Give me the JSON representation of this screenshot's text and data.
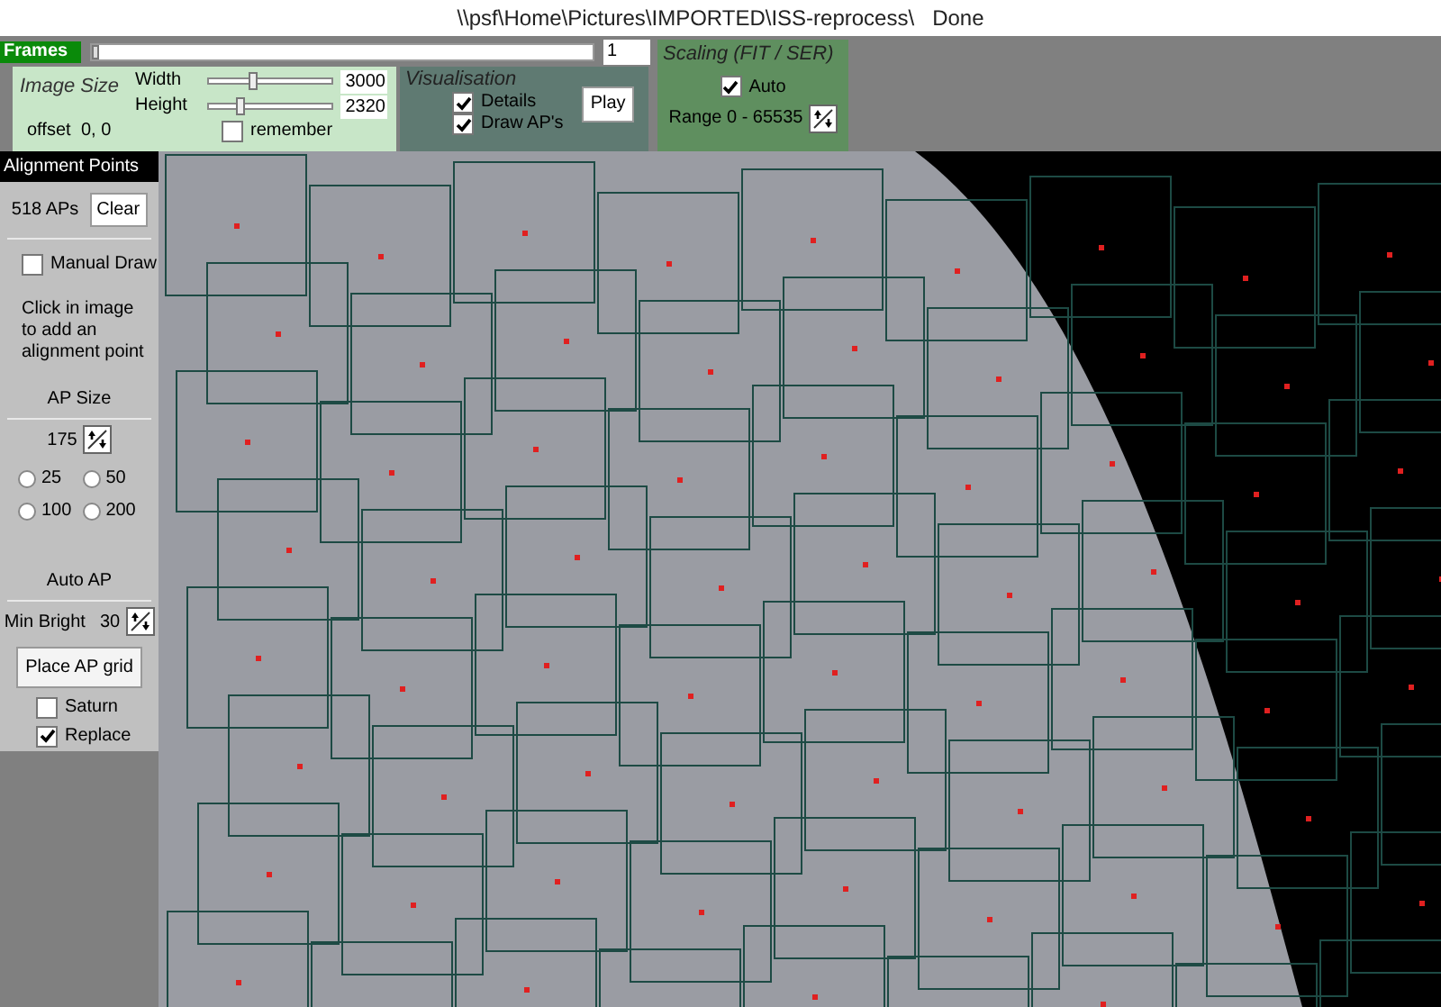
{
  "window": {
    "title": "\\\\psf\\Home\\Pictures\\IMPORTED\\ISS-reprocess\\   Done"
  },
  "frames": {
    "label": "Frames",
    "level": 0,
    "value": "1"
  },
  "image_size": {
    "title": "Image Size",
    "width_label": "Width",
    "width_slider": {
      "level": 0.35
    },
    "width_value": "3000",
    "height_label": "Height",
    "height_slider": {
      "level": 0.25
    },
    "height_value": "2320",
    "offset_label": "offset",
    "offset_value": "0, 0",
    "remember": {
      "label": "remember",
      "checked": false
    }
  },
  "visualisation": {
    "title": "Visualisation",
    "options": [
      {
        "label": "Details",
        "checked": true
      },
      {
        "label": "Draw AP's",
        "checked": true
      }
    ],
    "play": "Play"
  },
  "scaling": {
    "title": "Scaling (FIT / SER)",
    "auto": {
      "label": "Auto",
      "checked": true
    },
    "range": "Range 0 - 65535"
  },
  "sidebar": {
    "header": "Alignment Points",
    "count": "518 APs",
    "clear": "Clear",
    "manual_draw": {
      "label": "Manual Draw",
      "checked": false
    },
    "hint": "Click in image to add an alignment point",
    "ap_size_title": "AP Size",
    "ap_size_value": "175",
    "sizes": [
      {
        "label": "25",
        "selected": false
      },
      {
        "label": "50",
        "selected": false
      },
      {
        "label": "100",
        "selected": false
      },
      {
        "label": "200",
        "selected": false
      }
    ],
    "auto_ap_title": "Auto AP",
    "min_bright_label": "Min Bright",
    "min_bright_value": "30",
    "place_grid": "Place AP grid",
    "options": [
      {
        "label": "Saturn",
        "checked": false
      },
      {
        "label": "Replace",
        "checked": true
      }
    ]
  }
}
